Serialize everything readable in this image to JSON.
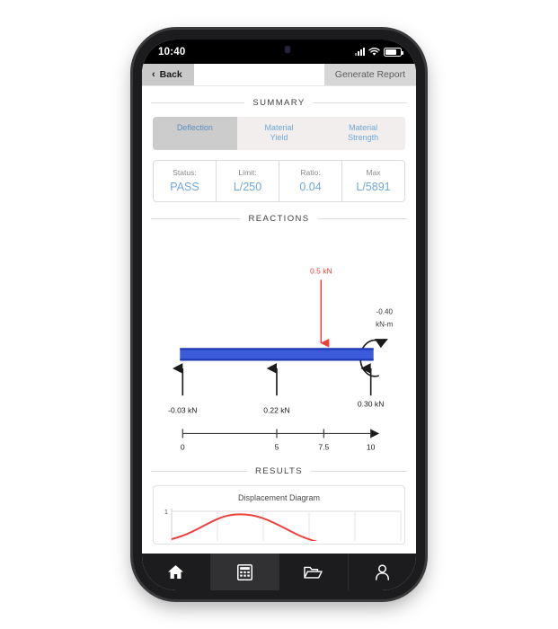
{
  "status_bar": {
    "time": "10:40",
    "icons": [
      "signal-bars-icon",
      "wifi-icon",
      "battery-icon"
    ]
  },
  "nav_bar": {
    "back_label": "Back",
    "back_chevron": "‹",
    "generate_report_label": "Generate Report"
  },
  "sections": {
    "summary_title": "SUMMARY",
    "reactions_title": "REACTIONS",
    "results_title": "RESULTS"
  },
  "check_tabs": [
    {
      "label": "Deflection",
      "active": true
    },
    {
      "label": "Material\nYield",
      "line1": "Material",
      "line2": "Yield",
      "active": false
    },
    {
      "label": "Material\nStrength",
      "line1": "Material",
      "line2": "Strength",
      "active": false
    }
  ],
  "summary_table": {
    "cells": [
      {
        "label": "Status:",
        "value": "PASS"
      },
      {
        "label": "Limit:",
        "value": "L/250"
      },
      {
        "label": "Ratio:",
        "value": "0.04"
      },
      {
        "label": "Max",
        "value": "L/5891"
      }
    ]
  },
  "chart_data": [
    {
      "type": "diagram",
      "title": "REACTIONS",
      "beam": {
        "start": 0,
        "end": 10,
        "color": "#3b5bdb",
        "edge_color": "#1c3bb3"
      },
      "axis": {
        "ticks": [
          0,
          5,
          7.5,
          10
        ],
        "tick_labels": [
          "0",
          "5",
          "7.5",
          "10"
        ],
        "arrow_end": true
      },
      "loads": [
        {
          "label": "0.5 kN",
          "value": 0.5,
          "x": 7.5,
          "direction": "down",
          "color": "#e8433a"
        }
      ],
      "reactions": [
        {
          "label": "-0.03 kN",
          "value": -0.03,
          "x": 0,
          "direction": "up"
        },
        {
          "label": "0.22 kN",
          "value": 0.22,
          "x": 5,
          "direction": "up"
        },
        {
          "label": "0.30 kN",
          "value": 0.3,
          "x": 10,
          "direction": "up"
        }
      ],
      "moments": [
        {
          "label_line1": "-0.40",
          "label_line2": "kN-m",
          "value": -0.4,
          "x": 10,
          "direction": "counterclockwise"
        }
      ]
    },
    {
      "type": "line",
      "title": "Displacement Diagram",
      "y_tick_labels": [
        "1"
      ],
      "ylim": [
        0,
        1
      ],
      "xlim": [
        0,
        10
      ],
      "grid": true,
      "series": [
        {
          "name": "displacement",
          "color": "#e8433a",
          "x": [
            0,
            1.25,
            2.5,
            3.75,
            5,
            6.25,
            7.5,
            8.75,
            10
          ],
          "y": [
            0.05,
            0.3,
            0.55,
            0.68,
            0.7,
            0.6,
            0.38,
            0.15,
            0.02
          ]
        }
      ]
    }
  ],
  "tab_bar": {
    "items": [
      {
        "name": "home-icon",
        "active": false
      },
      {
        "name": "calculator-icon",
        "active": true
      },
      {
        "name": "folder-icon",
        "active": false
      },
      {
        "name": "account-icon",
        "active": false
      }
    ]
  },
  "colors": {
    "accent_blue": "#6fa8dc",
    "beam_blue": "#3b5bdb",
    "load_red": "#e8433a",
    "tab_active_bg": "#cccccc"
  }
}
